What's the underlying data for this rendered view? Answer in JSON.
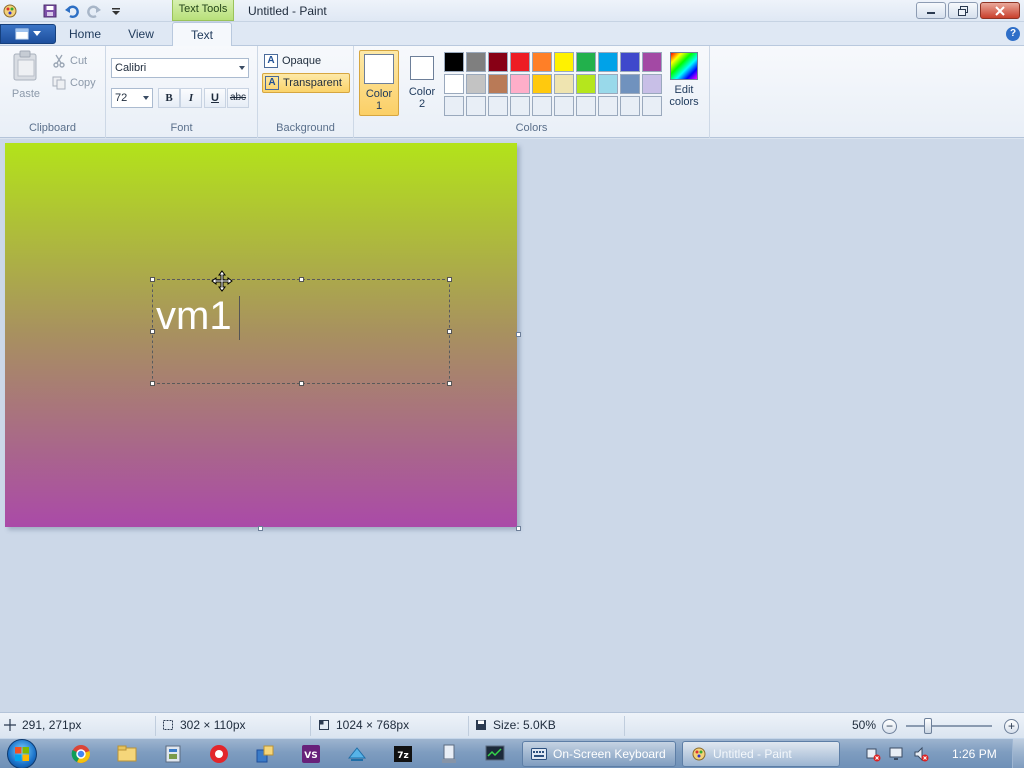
{
  "window": {
    "title": "Untitled - Paint",
    "context_tab": "Text Tools"
  },
  "ribbon_tabs": {
    "home": "Home",
    "view": "View",
    "text": "Text",
    "active": "Text"
  },
  "clipboard": {
    "paste": "Paste",
    "cut": "Cut",
    "copy": "Copy",
    "label": "Clipboard"
  },
  "font": {
    "family": "Calibri",
    "size": "72",
    "bold": "B",
    "italic": "I",
    "underline": "U",
    "strikethrough": "abc",
    "label": "Font"
  },
  "background": {
    "opaque": "Opaque",
    "transparent": "Transparent",
    "selected": "Transparent",
    "label": "Background"
  },
  "colors": {
    "color1_line1": "Color",
    "color1_line2": "1",
    "color2_line1": "Color",
    "color2_line2": "2",
    "edit_line1": "Edit",
    "edit_line2": "colors",
    "label": "Colors",
    "color1_value": "#ffffff",
    "color2_value": "#ffffff",
    "palette": [
      "#000000",
      "#7f7f7f",
      "#880015",
      "#ed1c24",
      "#ff7f27",
      "#fff200",
      "#22b14c",
      "#00a2e8",
      "#3f48cc",
      "#a349a4",
      "#ffffff",
      "#c3c3c3",
      "#b97a57",
      "#ffaec9",
      "#ffc90e",
      "#efe4b0",
      "#b5e61d",
      "#99d9ea",
      "#7092be",
      "#c8bfe7",
      "#e8eef6",
      "#e8eef6",
      "#e8eef6",
      "#e8eef6",
      "#e8eef6",
      "#e8eef6",
      "#e8eef6",
      "#e8eef6",
      "#e8eef6",
      "#e8eef6"
    ]
  },
  "canvas": {
    "text": "vm1",
    "gradient_top": "#b3e31a",
    "gradient_bottom": "#aa4aa8"
  },
  "status": {
    "cursor_pos": "291, 271px",
    "selection_size": "302 × 110px",
    "image_size": "1024 × 768px",
    "file_size": "Size: 5.0KB",
    "zoom": "50%"
  },
  "taskbar": {
    "tasks": [
      {
        "label": "On-Screen Keyboard"
      },
      {
        "label": "Untitled - Paint"
      }
    ],
    "clock": "1:26 PM"
  }
}
